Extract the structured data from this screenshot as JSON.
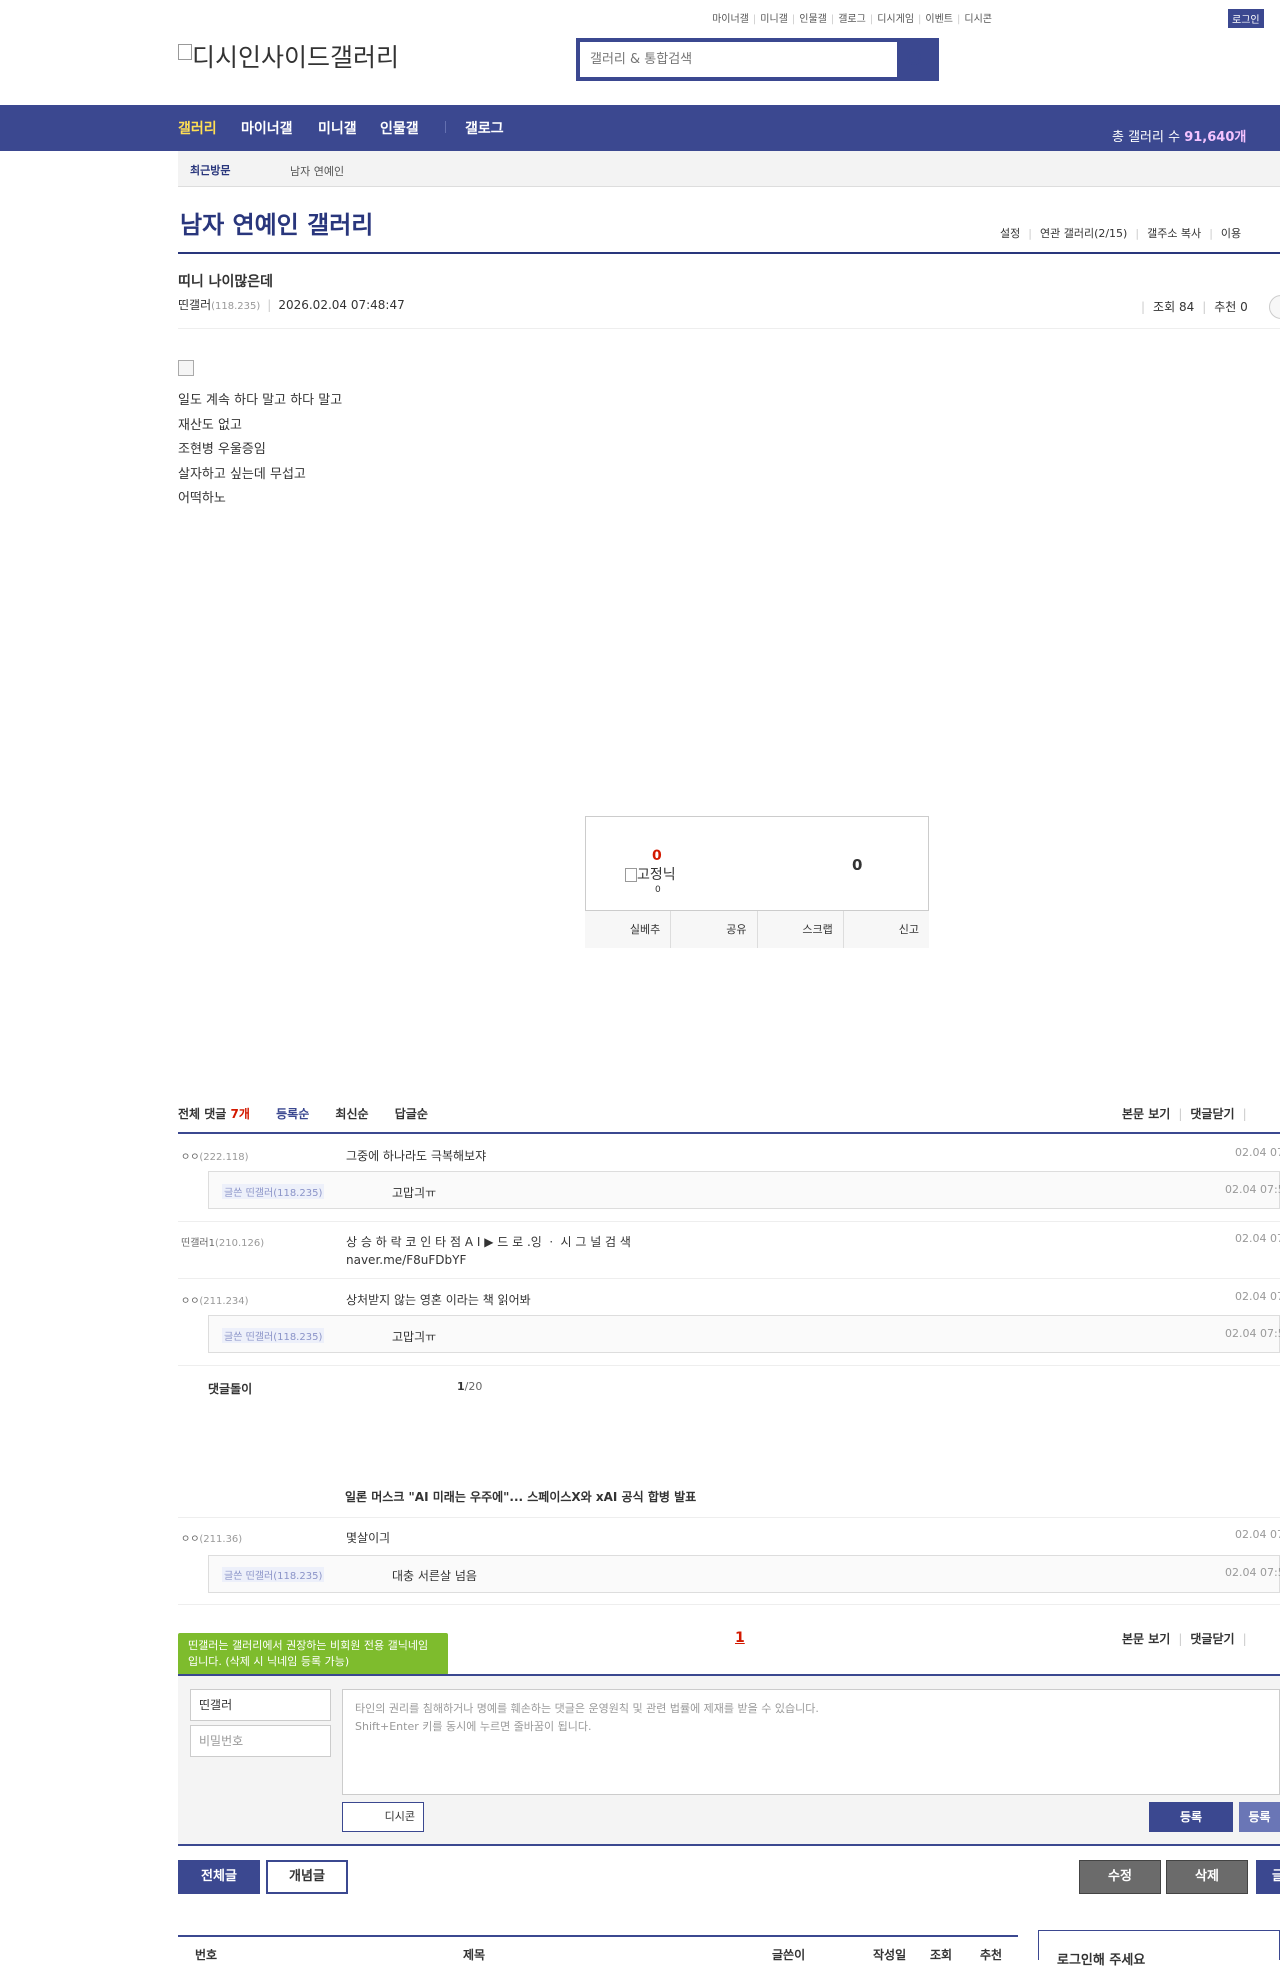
{
  "header": {
    "top_links": [
      "마이너갤",
      "미니갤",
      "인물갤",
      "갤로그",
      "디시게임",
      "이벤트",
      "디시콘"
    ],
    "login_label": "로그인",
    "logo_text": "디시인사이드갤러리",
    "search_placeholder": "갤러리 & 통합검색"
  },
  "nav": {
    "items": [
      "갤러리",
      "마이너갤",
      "미니갤",
      "인물갤",
      "갤로그"
    ],
    "total_label": "총 갤러리 수",
    "total_value": "91,640개"
  },
  "recent": {
    "label": "최근방문",
    "item": "남자 연예인"
  },
  "gallery": {
    "title": "남자 연예인 갤러리",
    "links": [
      "설정",
      "연관 갤러리(2/15)",
      "갤주소 복사",
      "이용"
    ]
  },
  "post": {
    "title": "띠니 나이많은데",
    "author": "띤갤러",
    "author_ip": "(118.235)",
    "date": "2026.02.04 07:48:47",
    "views_label": "조회 84",
    "recommend_label": "추천 0",
    "body_lines": [
      "일도 계속 하다 말고 하다 말고",
      "재산도 없고",
      "조현병 우울증임",
      "살자하고 싶는데 무섭고",
      "어떡하노"
    ]
  },
  "recommend": {
    "up_count": "0",
    "fixed_label": "고정닉",
    "fixed_count": "0",
    "down_count": "0",
    "buttons": [
      "실베추",
      "공유",
      "스크랩",
      "신고"
    ]
  },
  "comments": {
    "header_label": "전체 댓글",
    "count": "7개",
    "sort_tabs": [
      "등록순",
      "최신순",
      "답글순"
    ],
    "right_links": [
      "본문 보기",
      "댓글닫기"
    ],
    "items": [
      {
        "nick": "ㅇㅇ",
        "ip": "(222.118)",
        "text": "그중에 하나라도 극복해보쟈",
        "date": "02.04 07"
      },
      {
        "nick": "글쓴 띤갤러",
        "ip": "(118.235)",
        "text": "고맙긔ㅠ",
        "date": "02.04 07:5"
      },
      {
        "nick": "띤갤러1",
        "ip": "(210.126)",
        "text": "상 승 하 락 코 인 타 점 A I ▶ 드 로 .잉 ㆍ 시 그 널 검 색",
        "text2": "naver.me/F8uFDbYF",
        "date": "02.04 07"
      },
      {
        "nick": "ㅇㅇ",
        "ip": "(211.234)",
        "text": "상처받지 않는 영혼 이라는 책 읽어봐",
        "date": "02.04 07"
      },
      {
        "nick": "글쓴 띤갤러",
        "ip": "(118.235)",
        "text": "고맙긔ㅠ",
        "date": "02.04 07:5"
      }
    ],
    "dlbot_label": "댓글돌이",
    "page_current": "1",
    "page_total": "/20",
    "news_title": "일론 머스크 \"AI 미래는 우주에\"... 스페이스X와 xAI 공식 합병 발표",
    "extra_items": [
      {
        "nick": "ㅇㅇ",
        "ip": "(211.36)",
        "text": "몇살이긔",
        "date": "02.04 07"
      },
      {
        "nick": "글쓴 띤갤러",
        "ip": "(118.235)",
        "text": "대충 서른살 넘음",
        "date": "02.04 07:5"
      }
    ],
    "page_number": "1"
  },
  "write": {
    "tooltip": "띤갤러는 갤러리에서 권장하는 비회원 전용 갤닉네임입니다. (삭제 시 닉네임 등록 가능)",
    "nick_value": "띤갤러",
    "password_placeholder": "비밀번호",
    "memo_line1": "타인의 권리를 침해하거나 명예를 훼손하는 댓글은 운영원칙 및 관련 법률에 제재를 받을 수 있습니다.",
    "memo_line2": "Shift+Enter 키를 동시에 누르면 줄바꿈이 됩니다.",
    "dccon_label": "디시콘",
    "submit_label": "등록",
    "submit2_label": "등록"
  },
  "bottom": {
    "all_label": "전체글",
    "best_label": "개념글",
    "edit_label": "수정",
    "delete_label": "삭제",
    "write_label": "글"
  },
  "list": {
    "headers": [
      "번호",
      "제목",
      "글쓴이",
      "작성일",
      "조회",
      "추천"
    ],
    "login_prompt": "로그인해 주세요"
  },
  "colors": {
    "brand": "#3b4890",
    "accent_red": "#d31900",
    "tooltip_green": "#7ebc2d"
  }
}
